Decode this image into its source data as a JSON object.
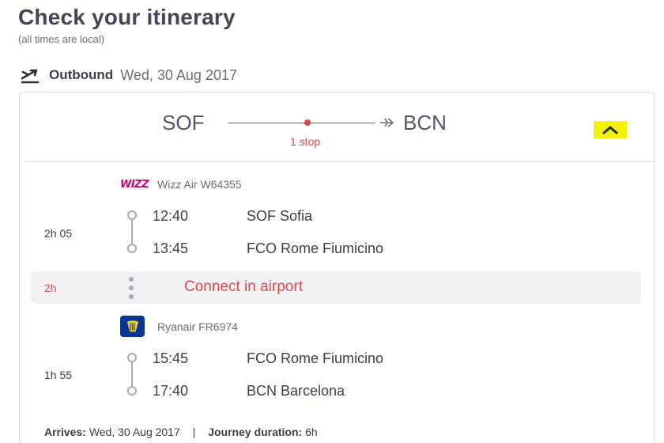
{
  "page": {
    "title": "Check your itinerary",
    "subtitle": "(all times are local)"
  },
  "outbound": {
    "direction_icon": "plane-takeoff-icon",
    "label": "Outbound",
    "date": "Wed, 30 Aug 2017"
  },
  "route": {
    "from": "SOF",
    "to": "BCN",
    "stops": "1 stop",
    "stop_color": "#e0474c",
    "collapse_icon": "chevron-up-icon",
    "collapse_highlight": "#f2f207"
  },
  "segments": [
    {
      "airline_logo_text": "WIZZ",
      "airline_logo_color": "#c6007e",
      "carrier": "Wizz Air W64355",
      "duration": "2h 05",
      "depart_time": "12:40",
      "depart_place": "SOF Sofia",
      "arrive_time": "13:45",
      "arrive_place": "FCO Rome Fiumicino"
    },
    {
      "airline_logo_icon": "ryanair-harp-icon",
      "airline_logo_color": "#073590",
      "carrier": "Ryanair FR6974",
      "duration": "1h 55",
      "depart_time": "15:45",
      "depart_place": "FCO Rome Fiumicino",
      "arrive_time": "17:40",
      "arrive_place": "BCN Barcelona"
    }
  ],
  "connection": {
    "duration": "2h",
    "text": "Connect in airport"
  },
  "footer": {
    "arrives_label": "Arrives:",
    "arrives_value": "Wed, 30 Aug 2017",
    "separator": "|",
    "journey_label": "Journey duration:",
    "journey_value": "6h"
  }
}
